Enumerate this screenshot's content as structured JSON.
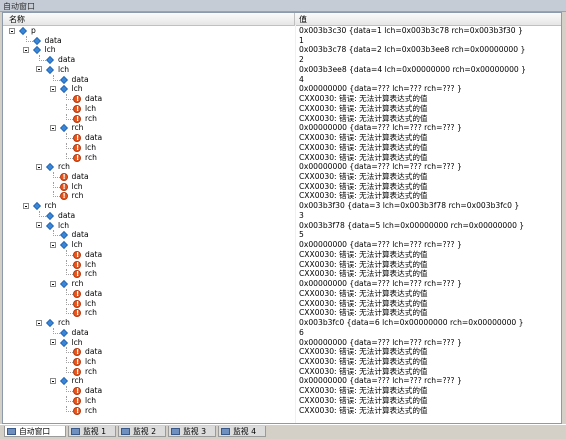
{
  "window_title": "自动窗口",
  "header": {
    "name_col": "名称",
    "value_col": "值"
  },
  "rows": [
    {
      "depth": 0,
      "toggle": true,
      "icon": "diamond",
      "name": "p",
      "value": "0x003b3c30 {data=1 lch=0x003b3c78 rch=0x003b3f30 }"
    },
    {
      "depth": 1,
      "toggle": false,
      "icon": "diamond",
      "name": "data",
      "value": "1"
    },
    {
      "depth": 1,
      "toggle": true,
      "icon": "diamond",
      "name": "lch",
      "value": "0x003b3c78 {data=2 lch=0x003b3ee8 rch=0x00000000 }"
    },
    {
      "depth": 2,
      "toggle": false,
      "icon": "diamond",
      "name": "data",
      "value": "2"
    },
    {
      "depth": 2,
      "toggle": true,
      "icon": "diamond",
      "name": "lch",
      "value": "0x003b3ee8 {data=4 lch=0x00000000 rch=0x00000000 }"
    },
    {
      "depth": 3,
      "toggle": false,
      "icon": "diamond",
      "name": "data",
      "value": "4"
    },
    {
      "depth": 3,
      "toggle": true,
      "icon": "diamond",
      "name": "lch",
      "value": "0x00000000 {data=??? lch=??? rch=??? }"
    },
    {
      "depth": 4,
      "toggle": false,
      "icon": "err",
      "name": "data",
      "value": "CXX0030: 错误: 无法计算表达式的值"
    },
    {
      "depth": 4,
      "toggle": false,
      "icon": "err",
      "name": "lch",
      "value": "CXX0030: 错误: 无法计算表达式的值"
    },
    {
      "depth": 4,
      "toggle": false,
      "icon": "err",
      "name": "rch",
      "value": "CXX0030: 错误: 无法计算表达式的值"
    },
    {
      "depth": 3,
      "toggle": true,
      "icon": "diamond",
      "name": "rch",
      "value": "0x00000000 {data=??? lch=??? rch=??? }"
    },
    {
      "depth": 4,
      "toggle": false,
      "icon": "err",
      "name": "data",
      "value": "CXX0030: 错误: 无法计算表达式的值"
    },
    {
      "depth": 4,
      "toggle": false,
      "icon": "err",
      "name": "lch",
      "value": "CXX0030: 错误: 无法计算表达式的值"
    },
    {
      "depth": 4,
      "toggle": false,
      "icon": "err",
      "name": "rch",
      "value": "CXX0030: 错误: 无法计算表达式的值"
    },
    {
      "depth": 2,
      "toggle": true,
      "icon": "diamond",
      "name": "rch",
      "value": "0x00000000 {data=??? lch=??? rch=??? }"
    },
    {
      "depth": 3,
      "toggle": false,
      "icon": "err",
      "name": "data",
      "value": "CXX0030: 错误: 无法计算表达式的值"
    },
    {
      "depth": 3,
      "toggle": false,
      "icon": "err",
      "name": "lch",
      "value": "CXX0030: 错误: 无法计算表达式的值"
    },
    {
      "depth": 3,
      "toggle": false,
      "icon": "err",
      "name": "rch",
      "value": "CXX0030: 错误: 无法计算表达式的值"
    },
    {
      "depth": 1,
      "toggle": true,
      "icon": "diamond",
      "name": "rch",
      "value": "0x003b3f30 {data=3 lch=0x003b3f78 rch=0x003b3fc0 }"
    },
    {
      "depth": 2,
      "toggle": false,
      "icon": "diamond",
      "name": "data",
      "value": "3"
    },
    {
      "depth": 2,
      "toggle": true,
      "icon": "diamond",
      "name": "lch",
      "value": "0x003b3f78 {data=5 lch=0x00000000 rch=0x00000000 }"
    },
    {
      "depth": 3,
      "toggle": false,
      "icon": "diamond",
      "name": "data",
      "value": "5"
    },
    {
      "depth": 3,
      "toggle": true,
      "icon": "diamond",
      "name": "lch",
      "value": "0x00000000 {data=??? lch=??? rch=??? }"
    },
    {
      "depth": 4,
      "toggle": false,
      "icon": "err",
      "name": "data",
      "value": "CXX0030: 错误: 无法计算表达式的值"
    },
    {
      "depth": 4,
      "toggle": false,
      "icon": "err",
      "name": "lch",
      "value": "CXX0030: 错误: 无法计算表达式的值"
    },
    {
      "depth": 4,
      "toggle": false,
      "icon": "err",
      "name": "rch",
      "value": "CXX0030: 错误: 无法计算表达式的值"
    },
    {
      "depth": 3,
      "toggle": true,
      "icon": "diamond",
      "name": "rch",
      "value": "0x00000000 {data=??? lch=??? rch=??? }"
    },
    {
      "depth": 4,
      "toggle": false,
      "icon": "err",
      "name": "data",
      "value": "CXX0030: 错误: 无法计算表达式的值"
    },
    {
      "depth": 4,
      "toggle": false,
      "icon": "err",
      "name": "lch",
      "value": "CXX0030: 错误: 无法计算表达式的值"
    },
    {
      "depth": 4,
      "toggle": false,
      "icon": "err",
      "name": "rch",
      "value": "CXX0030: 错误: 无法计算表达式的值"
    },
    {
      "depth": 2,
      "toggle": true,
      "icon": "diamond",
      "name": "rch",
      "value": "0x003b3fc0 {data=6 lch=0x00000000 rch=0x00000000 }"
    },
    {
      "depth": 3,
      "toggle": false,
      "icon": "diamond",
      "name": "data",
      "value": "6"
    },
    {
      "depth": 3,
      "toggle": true,
      "icon": "diamond",
      "name": "lch",
      "value": "0x00000000 {data=??? lch=??? rch=??? }"
    },
    {
      "depth": 4,
      "toggle": false,
      "icon": "err",
      "name": "data",
      "value": "CXX0030: 错误: 无法计算表达式的值"
    },
    {
      "depth": 4,
      "toggle": false,
      "icon": "err",
      "name": "lch",
      "value": "CXX0030: 错误: 无法计算表达式的值"
    },
    {
      "depth": 4,
      "toggle": false,
      "icon": "err",
      "name": "rch",
      "value": "CXX0030: 错误: 无法计算表达式的值"
    },
    {
      "depth": 3,
      "toggle": true,
      "icon": "diamond",
      "name": "rch",
      "value": "0x00000000 {data=??? lch=??? rch=??? }"
    },
    {
      "depth": 4,
      "toggle": false,
      "icon": "err",
      "name": "data",
      "value": "CXX0030: 错误: 无法计算表达式的值"
    },
    {
      "depth": 4,
      "toggle": false,
      "icon": "err",
      "name": "lch",
      "value": "CXX0030: 错误: 无法计算表达式的值"
    },
    {
      "depth": 4,
      "toggle": false,
      "icon": "err",
      "name": "rch",
      "value": "CXX0030: 错误: 无法计算表达式的值"
    }
  ],
  "tabs": [
    {
      "label": "自动窗口",
      "active": true
    },
    {
      "label": "监视 1",
      "active": false
    },
    {
      "label": "监视 2",
      "active": false
    },
    {
      "label": "监视 3",
      "active": false
    },
    {
      "label": "监视 4",
      "active": false
    }
  ]
}
